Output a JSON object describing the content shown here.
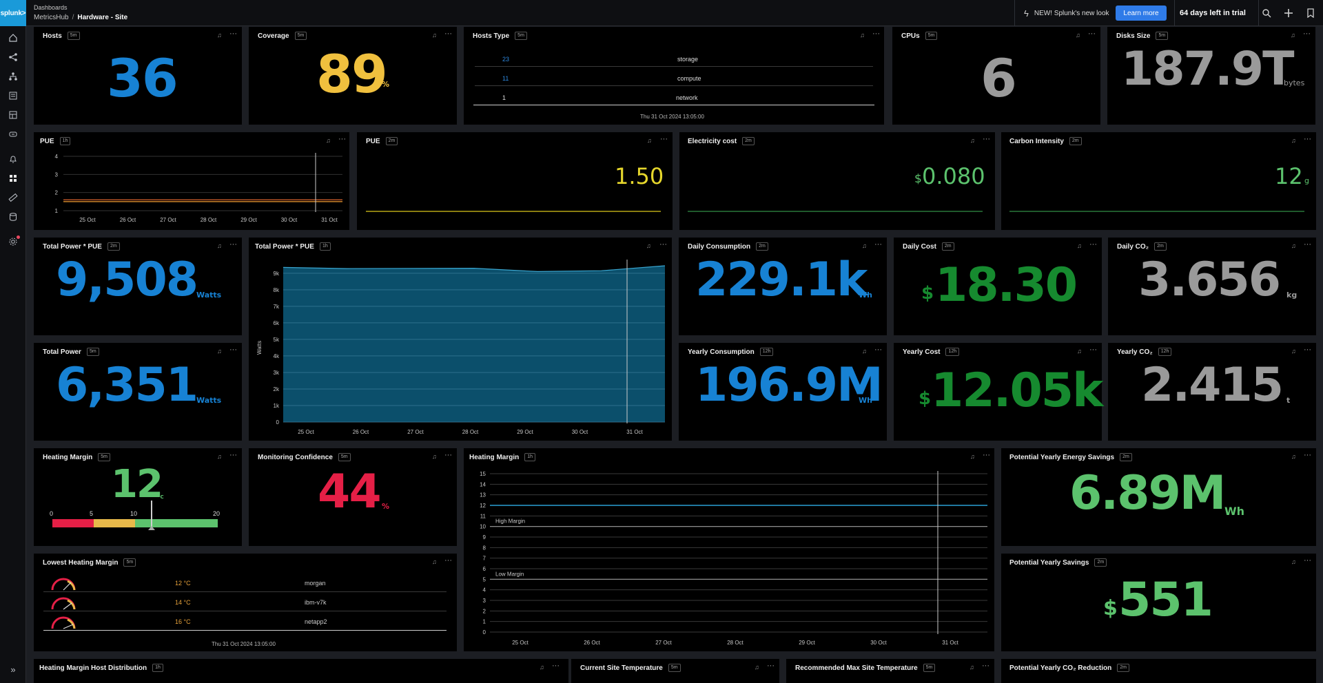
{
  "topbar": {
    "logo": "splunk>",
    "crumb_top": "Dashboards",
    "crumb_parent": "MetricsHub",
    "crumb_sep": "/",
    "crumb_current": "Hardware - Site",
    "new_look": "NEW! Splunk's new look",
    "learn_more": "Learn more",
    "trial": "64 days left in trial"
  },
  "nav": {
    "icons": [
      "home-icon",
      "flow-icon",
      "hierarchy-icon",
      "list-icon",
      "table-icon",
      "infrastructure-icon",
      "bell-icon",
      "dashboard-icon",
      "ruler-icon",
      "database-icon",
      "settings-icon"
    ],
    "expand": "»"
  },
  "panels": {
    "hosts": {
      "title": "Hosts",
      "badge": "5m",
      "value": "36"
    },
    "coverage": {
      "title": "Coverage",
      "badge": "5m",
      "value": "89",
      "unit": "%"
    },
    "hosts_type": {
      "title": "Hosts Type",
      "badge": "5m",
      "rows": [
        {
          "count": "23",
          "type": "storage"
        },
        {
          "count": "11",
          "type": "compute"
        },
        {
          "count": "1",
          "type": "network"
        }
      ],
      "timestamp": "Thu 31 Oct 2024 13:05:00"
    },
    "cpus": {
      "title": "CPUs",
      "badge": "5m",
      "value": "6"
    },
    "disks": {
      "title": "Disks Size",
      "badge": "5m",
      "value": "187.9T",
      "unit": "bytes"
    },
    "pue_chart": {
      "title": "PUE",
      "badge": "1h"
    },
    "pue": {
      "title": "PUE",
      "badge": "2m",
      "value": "1.50"
    },
    "electricity": {
      "title": "Electricity cost",
      "badge": "2m",
      "prefix": "$",
      "value": "0.080"
    },
    "carbon": {
      "title": "Carbon Intensity",
      "badge": "2m",
      "value": "12",
      "unit": "g"
    },
    "total_power_pue": {
      "title": "Total Power * PUE",
      "badge": "2m",
      "value": "9,508",
      "unit": "Watts"
    },
    "total_power_pue_chart": {
      "title": "Total Power * PUE",
      "badge": "1h"
    },
    "daily_consumption": {
      "title": "Daily Consumption",
      "badge": "2m",
      "value": "229.1k",
      "unit": "Wh"
    },
    "daily_cost": {
      "title": "Daily Cost",
      "badge": "2m",
      "prefix": "$",
      "value": "18.30"
    },
    "daily_co2": {
      "title": "Daily CO₂",
      "badge": "2m",
      "value": "3.656",
      "unit": "kg"
    },
    "total_power": {
      "title": "Total Power",
      "badge": "5m",
      "value": "6,351",
      "unit": "Watts"
    },
    "yearly_consumption": {
      "title": "Yearly Consumption",
      "badge": "12h",
      "value": "196.9M",
      "unit": "Wh"
    },
    "yearly_cost": {
      "title": "Yearly Cost",
      "badge": "12h",
      "prefix": "$",
      "value": "12.05k"
    },
    "yearly_co2": {
      "title": "Yearly CO₂",
      "badge": "12h",
      "value": "2.415",
      "unit": "t"
    },
    "heating_margin": {
      "title": "Heating Margin",
      "badge": "5m",
      "value": "12",
      "unit": "°C",
      "scale": [
        "0",
        "5",
        "10",
        "20"
      ]
    },
    "monitoring_confidence": {
      "title": "Monitoring Confidence",
      "badge": "5m",
      "value": "44",
      "unit": "%"
    },
    "heating_margin_chart": {
      "title": "Heating Margin",
      "badge": "1h"
    },
    "potential_energy": {
      "title": "Potential Yearly Energy Savings",
      "badge": "2m",
      "value": "6.89M",
      "unit": "Wh"
    },
    "lowest_heating": {
      "title": "Lowest Heating Margin",
      "badge": "5m",
      "rows": [
        {
          "temp": "12 °C",
          "host": "morgan"
        },
        {
          "temp": "14 °C",
          "host": "ibm-v7k"
        },
        {
          "temp": "16 °C",
          "host": "netapp2"
        }
      ],
      "timestamp": "Thu 31 Oct 2024 13:05:00"
    },
    "potential_savings": {
      "title": "Potential Yearly Savings",
      "badge": "2m",
      "prefix": "$",
      "value": "551"
    },
    "hm_distribution": {
      "title": "Heating Margin Host Distribution",
      "badge": "1h"
    },
    "current_temp": {
      "title": "Current Site Temperature",
      "badge": "5m"
    },
    "recommended_temp": {
      "title": "Recommended Max Site Temperature",
      "badge": "5m"
    },
    "potential_co2": {
      "title": "Potential Yearly CO₂ Reduction",
      "badge": "2m"
    }
  },
  "chart_data": [
    {
      "type": "line",
      "x": [
        "25 Oct",
        "26 Oct",
        "27 Oct",
        "28 Oct",
        "29 Oct",
        "30 Oct",
        "31 Oct"
      ],
      "ylim": [
        1,
        4
      ],
      "yticks": [
        1,
        2,
        3,
        4
      ],
      "series": [
        {
          "values": [
            1.5,
            1.5,
            1.5,
            1.5,
            1.5,
            1.5,
            1.5
          ],
          "color": "#e0902e"
        },
        {
          "values": [
            1.6,
            1.6,
            1.6,
            1.6,
            1.6,
            1.6,
            1.6
          ],
          "color": "#c85a2a"
        }
      ]
    },
    {
      "type": "area",
      "x": [
        "25 Oct",
        "26 Oct",
        "27 Oct",
        "28 Oct",
        "29 Oct",
        "30 Oct",
        "31 Oct"
      ],
      "ylabel": "Watts",
      "yticks": [
        "0",
        "1k",
        "2k",
        "3k",
        "4k",
        "5k",
        "6k",
        "7k",
        "8k",
        "9k"
      ],
      "ylim": [
        0,
        9700
      ],
      "series": [
        {
          "values": [
            9350,
            9280,
            9290,
            9300,
            9100,
            9150,
            9450
          ],
          "color": "#0f6a8f"
        }
      ]
    },
    {
      "type": "line",
      "x": [
        "25 Oct",
        "26 Oct",
        "27 Oct",
        "28 Oct",
        "29 Oct",
        "30 Oct",
        "31 Oct"
      ],
      "ylim": [
        0,
        15
      ],
      "yticks": [
        0,
        1,
        2,
        3,
        4,
        5,
        6,
        7,
        8,
        9,
        10,
        11,
        12,
        13,
        14,
        15
      ],
      "series": [
        {
          "values": [
            12,
            12,
            12,
            12,
            12,
            12,
            12
          ],
          "color": "#2a9fd6"
        }
      ],
      "thresholds": [
        {
          "name": "High Margin",
          "value": 10
        },
        {
          "name": "Low Margin",
          "value": 5
        }
      ]
    }
  ]
}
